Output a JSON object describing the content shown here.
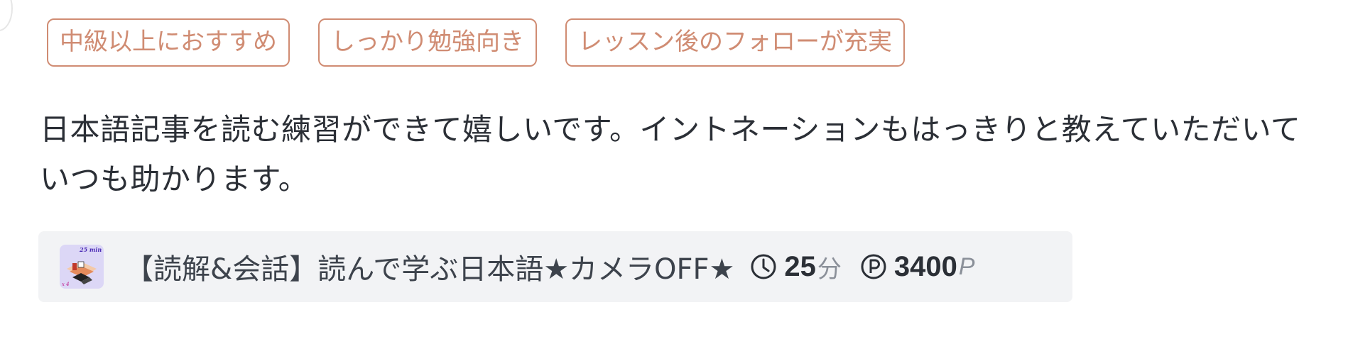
{
  "tags": [
    {
      "label": "中級以上におすすめ"
    },
    {
      "label": "しっかり勉強向き"
    },
    {
      "label": "レッスン後のフォローが充実"
    }
  ],
  "review": {
    "text": "日本語記事を読む練習ができて嬉しいです。イントネーションもはっきりと教えていただいていつも助かります。"
  },
  "lesson": {
    "thumbnail_caption": "25 min",
    "thumbnail_badge": "x 4",
    "title": "【読解&会話】読んで学ぶ日本語★カメラOFF★",
    "duration_icon": "clock-icon",
    "duration_value": "25",
    "duration_unit": "分",
    "points_icon": "points-icon",
    "points_value": "3400",
    "points_unit": "P"
  },
  "colors": {
    "tag_accent": "#d08c73",
    "card_background": "#f2f3f5",
    "text_primary": "#2b2f36",
    "text_muted": "#8b9099"
  }
}
